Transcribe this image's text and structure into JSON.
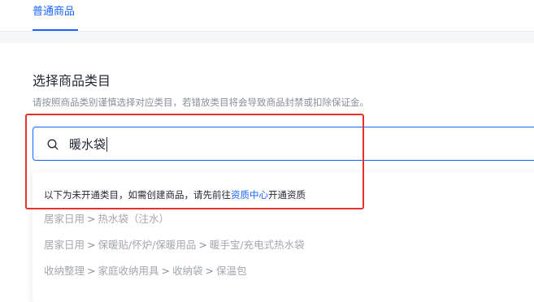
{
  "tabs": {
    "active_label": "普通商品"
  },
  "category": {
    "title": "选择商品类目",
    "hint": "请按照商品类别谨慎选择对应类目，若错放类目将会导致商品封禁或扣除保证金。"
  },
  "search": {
    "value": "暖水袋"
  },
  "dropdown": {
    "notice_prefix": "以下为未开通类目，如需创建商品，请先前往",
    "notice_link": "资质中心",
    "notice_suffix": "开通资质",
    "separator": ">",
    "results": [
      {
        "path": [
          "居家日用",
          "热水袋（注水）"
        ]
      },
      {
        "path": [
          "居家日用",
          "保暖贴/怀炉/保暖用品",
          "暖手宝/充电式热水袋"
        ]
      },
      {
        "path": [
          "收纳整理",
          "家庭收纳用具",
          "收纳袋",
          "保温包"
        ]
      }
    ]
  },
  "colors": {
    "accent": "#1966ff",
    "highlight": "#e6322c",
    "disabled_text": "#a3a6ad"
  }
}
